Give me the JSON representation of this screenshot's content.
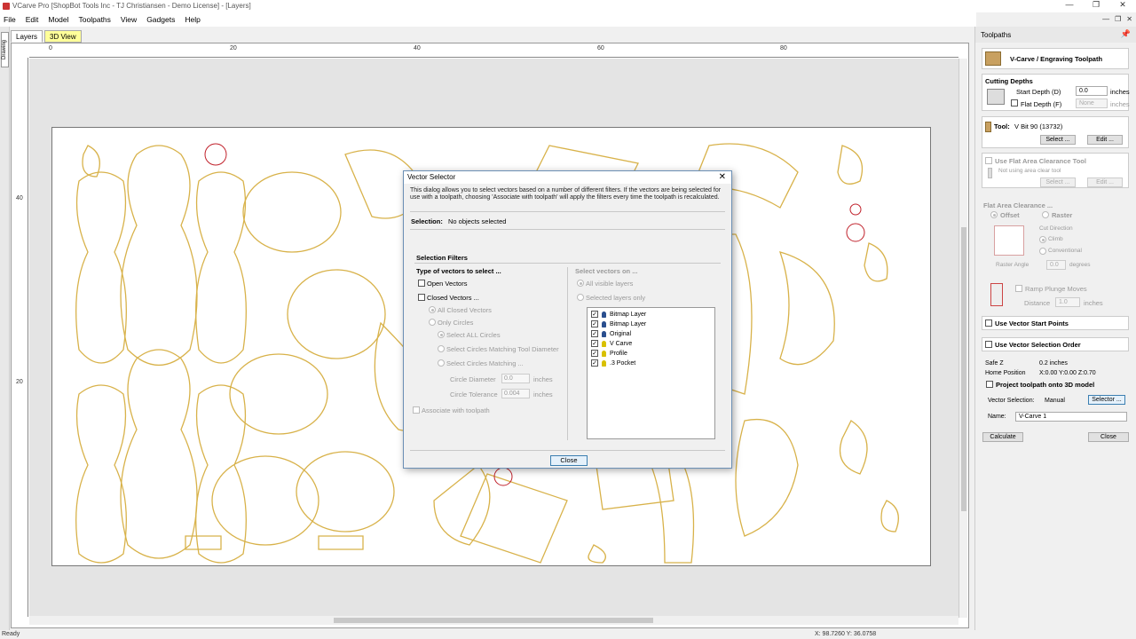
{
  "window": {
    "title": "VCarve Pro [ShopBot Tools Inc - TJ Christiansen - Demo License] - [Layers]",
    "controls": [
      "—",
      "❐",
      "✕"
    ]
  },
  "menu": [
    "File",
    "Edit",
    "Model",
    "Toolpaths",
    "View",
    "Gadgets",
    "Help"
  ],
  "mdi_controls": [
    "—",
    "❐",
    "✕"
  ],
  "left_toolbar": {
    "drawing_tab": "Drawing"
  },
  "view_tabs": {
    "layers": "Layers",
    "view3d": "3D View"
  },
  "ruler_h": [
    "0",
    "20",
    "40",
    "60",
    "80"
  ],
  "ruler_v": [
    "40",
    "20"
  ],
  "status": {
    "left": "Ready",
    "coords": "X: 98.7260 Y: 36.0758"
  },
  "dialog": {
    "title": "Vector Selector",
    "close_glyph": "✕",
    "description": "This dialog allows you to select vectors based on a number of different filters. If the vectors are being selected for use with a toolpath, choosing 'Associate with toolpath' will apply the filters every time the toolpath is recalculated.",
    "selection_label": "Selection:",
    "selection_value": "No objects selected",
    "filters_heading": "Selection Filters",
    "type_heading": "Type of vectors to select ...",
    "open_vectors": "Open Vectors",
    "closed_vectors": "Closed Vectors ...",
    "all_closed": "All Closed Vectors",
    "only_circles": "Only Circles",
    "select_all_circles": "Select ALL Circles",
    "match_tool": "Select Circles Matching Tool Diameter",
    "matching": "Select Circles Matching ...",
    "circle_diameter_label": "Circle Diameter",
    "circle_diameter_value": "0.0",
    "circle_tolerance_label": "Circle Tolerance",
    "circle_tolerance_value": "0.004",
    "inches": "inches",
    "associate": "Associate with toolpath",
    "select_on_heading": "Select vectors on ...",
    "all_visible": "All visible layers",
    "selected_only": "Selected layers only",
    "layers": [
      {
        "name": "Bitmap Layer",
        "color": "#2a4f8f"
      },
      {
        "name": "Bitmap Layer",
        "color": "#2a4f8f"
      },
      {
        "name": "Original",
        "color": "#2a4f8f"
      },
      {
        "name": "V Carve",
        "color": "#d8c000"
      },
      {
        "name": "Profile",
        "color": "#d8c000"
      },
      {
        "name": ".3 Pocket",
        "color": "#d8c000"
      }
    ],
    "check_glyph": "✓",
    "close_button": "Close"
  },
  "panel": {
    "header": "Toolpaths",
    "pin": "📌",
    "title": "V-Carve / Engraving Toolpath",
    "cutting_depths": "Cutting Depths",
    "start_depth_label": "Start Depth (D)",
    "start_depth_value": "0.0",
    "flat_depth_label": "Flat Depth (F)",
    "flat_depth_value": "None",
    "inches": "inches",
    "tool_label": "Tool:",
    "tool_value": "V Bit 90 (13732)",
    "select_btn": "Select ...",
    "edit_btn": "Edit ...",
    "flat_area_tool": "Use Flat Area Clearance Tool",
    "not_using": "Not using area clear tool",
    "flat_area_heading": "Flat Area Clearance ...",
    "offset": "Offset",
    "raster": "Raster",
    "cut_direction": "Cut Direction",
    "climb": "Climb",
    "conventional": "Conventional",
    "raster_angle_label": "Raster Angle",
    "raster_angle_value": "0.0",
    "degrees": "degrees",
    "ramp_plunge": "Ramp Plunge Moves",
    "distance_label": "Distance",
    "distance_value": "1.0",
    "start_points": "Use Vector Start Points",
    "selection_order": "Use Vector Selection Order",
    "safe_z_label": "Safe Z",
    "safe_z_value": "0.2 inches",
    "home_label": "Home Position",
    "home_value": "X:0.00 Y:0.00 Z:0.70",
    "project": "Project toolpath onto 3D model",
    "vector_selection_label": "Vector Selection:",
    "vector_selection_value": "Manual",
    "selector_btn": "Selector ...",
    "name_label": "Name:",
    "name_value": "V-Carve 1",
    "calculate": "Calculate",
    "close": "Close"
  }
}
